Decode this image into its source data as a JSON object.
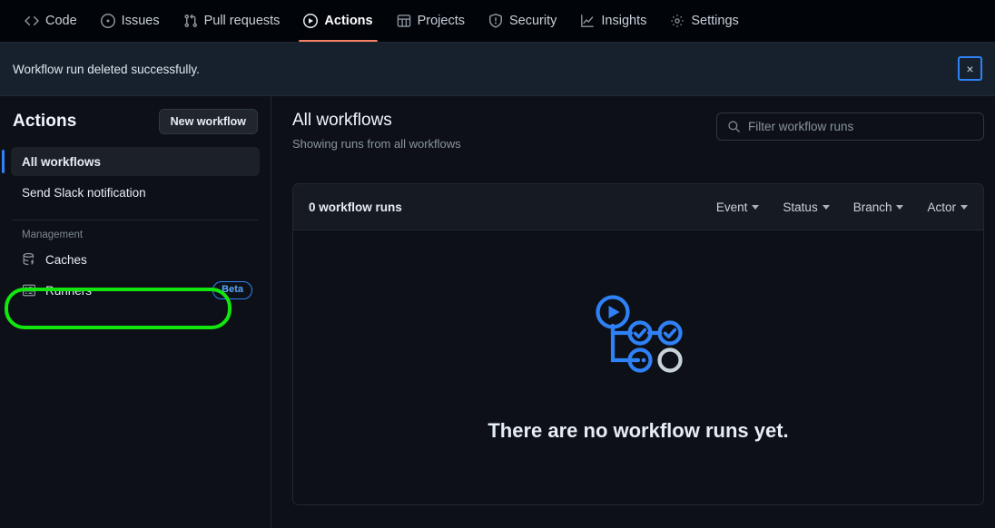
{
  "repo_nav": {
    "items": [
      {
        "label": "Code",
        "icon": "code-icon",
        "active": false
      },
      {
        "label": "Issues",
        "icon": "issue-icon",
        "active": false
      },
      {
        "label": "Pull requests",
        "icon": "pr-icon",
        "active": false
      },
      {
        "label": "Actions",
        "icon": "play-icon",
        "active": true
      },
      {
        "label": "Projects",
        "icon": "table-icon",
        "active": false
      },
      {
        "label": "Security",
        "icon": "shield-icon",
        "active": false
      },
      {
        "label": "Insights",
        "icon": "graph-icon",
        "active": false
      },
      {
        "label": "Settings",
        "icon": "gear-icon",
        "active": false
      }
    ],
    "active_underline_color": "#f78166"
  },
  "flash": {
    "message": "Workflow run deleted successfully.",
    "close_icon": "close-icon",
    "close_label": "×",
    "background": "#17212d",
    "focus_ring_color": "#2f81f7"
  },
  "sidebar": {
    "title": "Actions",
    "new_workflow_label": "New workflow",
    "workflows": [
      {
        "label": "All workflows",
        "selected": true,
        "highlighted": false
      },
      {
        "label": "Send Slack notification",
        "selected": false,
        "highlighted": true
      }
    ],
    "management_label": "Management",
    "management_items": [
      {
        "label": "Caches",
        "icon": "cache-icon",
        "badge": ""
      },
      {
        "label": "Runners",
        "icon": "server-icon",
        "badge": "Beta"
      }
    ],
    "selected_indicator_color": "#2f81f7",
    "highlight_color": "#13e60e"
  },
  "main": {
    "title": "All workflows",
    "subtitle": "Showing runs from all workflows",
    "search": {
      "icon": "search-icon",
      "placeholder": "Filter workflow runs",
      "value": ""
    },
    "runs_panel": {
      "count_label": "0 workflow runs",
      "filters": [
        {
          "label": "Event",
          "icon": "chevron-down-icon"
        },
        {
          "label": "Status",
          "icon": "chevron-down-icon"
        },
        {
          "label": "Branch",
          "icon": "chevron-down-icon"
        },
        {
          "label": "Actor",
          "icon": "chevron-down-icon"
        }
      ],
      "empty_state": {
        "illustration": "workflow-graph-illustration",
        "title": "There are no workflow runs yet."
      }
    }
  }
}
